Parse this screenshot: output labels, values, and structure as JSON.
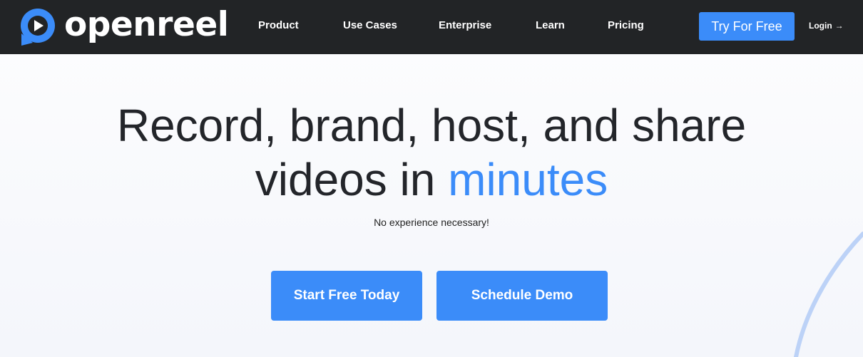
{
  "brand": {
    "name": "openreel",
    "color": "#3b8cf9",
    "logo_icon": "play-bubble-icon"
  },
  "nav": {
    "items": [
      {
        "label": "Product"
      },
      {
        "label": "Use Cases"
      },
      {
        "label": "Enterprise"
      },
      {
        "label": "Learn"
      },
      {
        "label": "Pricing"
      }
    ],
    "cta_label": "Try For Free",
    "login_label": "Login",
    "login_icon": "arrow-right-icon",
    "background": "#222426"
  },
  "hero": {
    "title_line1": "Record, brand, host, and share",
    "title_line2_plain": "videos in ",
    "title_line2_accent": "minutes",
    "subtitle": "No experience necessary!",
    "primary_cta": "Start Free Today",
    "secondary_cta": "Schedule Demo"
  }
}
